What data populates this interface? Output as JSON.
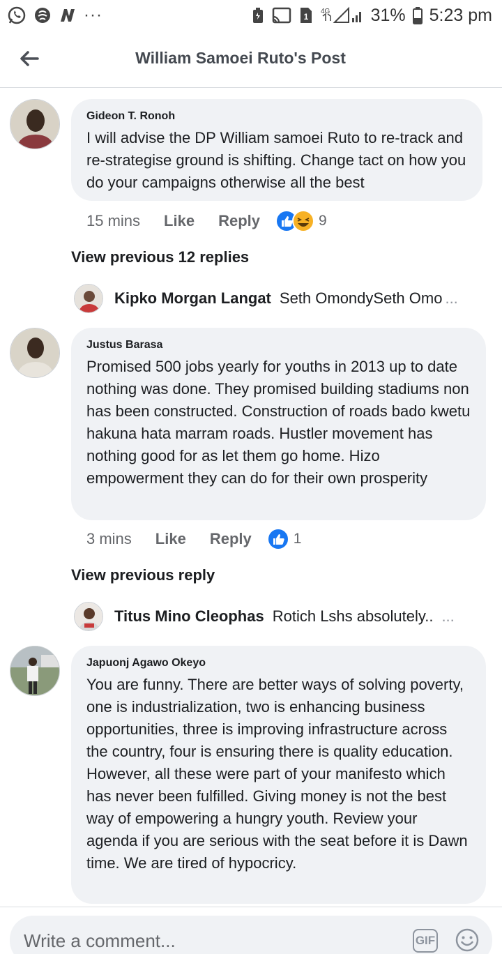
{
  "status_bar": {
    "battery": "31%",
    "time": "5:23 pm",
    "network": "4G",
    "sim": "1",
    "more": "···"
  },
  "header": {
    "title": "William Samoei Ruto's Post"
  },
  "comments": [
    {
      "author": "Gideon T. Ronoh",
      "text": "I will advise the DP William samoei Ruto to re-track and re-strategise ground is shifting. Change tact on how you do your campaigns otherwise all the best",
      "time": "15 mins",
      "like": "Like",
      "reply": "Reply",
      "reactions": [
        "like-icon",
        "haha-icon"
      ],
      "reaction_count": "9",
      "view_previous": "View previous 12 replies",
      "reply_preview": {
        "name": "Kipko Morgan Langat",
        "snippet": "Seth OmondySeth Omo",
        "ellipsis": "..."
      }
    },
    {
      "author": "Justus Barasa",
      "text": "Promised 500 jobs yearly for youths in 2013 up to date nothing was done. They promised building stadiums non has been constructed. Construction of roads bado kwetu hakuna hata marram roads. Hustler movement has nothing good for as let them go home. Hizo empowerment they can do for their own prosperity",
      "time": "3 mins",
      "like": "Like",
      "reply": "Reply",
      "reactions": [
        "like-icon"
      ],
      "reaction_count": "1",
      "view_previous": "View previous reply",
      "reply_preview": {
        "name": "Titus Mino Cleophas",
        "snippet": "Rotich Lshs absolutely..",
        "ellipsis": "..."
      }
    },
    {
      "author": "Japuonj Agawo Okeyo",
      "text": "You are funny. There are better ways of solving poverty, one is industrialization, two is enhancing business opportunities, three is improving infrastructure across the country, four is ensuring there is quality education. However, all these were part of your manifesto which has never been fulfilled. Giving money is not the best way of empowering a hungry youth. Review your agenda if you are serious with the seat before it is Dawn time. We are tired of hypocricy."
    }
  ],
  "composer": {
    "placeholder": "Write a comment...",
    "gif_label": "GIF"
  },
  "colors": {
    "like_blue": "#1877f2",
    "haha_yellow": "#f7b125",
    "bubble_bg": "#f0f2f5",
    "muted_text": "#65676b"
  }
}
